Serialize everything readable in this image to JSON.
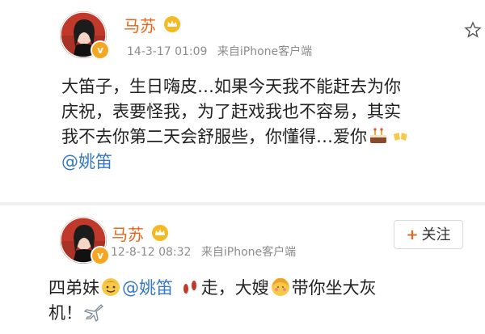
{
  "post1": {
    "username": "马苏",
    "timestamp": "14-3-17 01:09",
    "source": "来自iPhone客户端",
    "content_lines": [
      "大笛子，生日嗨皮…如果今天我不能赶去为你",
      "庆祝，表要怪我，为了赶戏我也不容易，其实",
      "我不去你第二天会舒服些，你懂得…爱你"
    ],
    "mention": "@姚笛",
    "avatar_icon": "avatar-icon",
    "verified_badge": "v",
    "emojis": [
      "cake-emoji",
      "cheers-emoji"
    ]
  },
  "post2": {
    "username": "马苏",
    "timestamp": "12-8-12 08:32",
    "source": "来自iPhone客户端",
    "follow_label": "+关注",
    "content_part1": "四弟妹",
    "mention": "@姚笛",
    "content_part2": "走，大嫂",
    "content_part3": "带你坐大灰",
    "content_line2": "机！",
    "avatar_icon": "avatar-icon",
    "verified_badge": "v",
    "emojis": [
      "smile-emoji",
      "footprints-emoji",
      "shy-emoji",
      "airplane-emoji"
    ]
  },
  "colors": {
    "username": "#e8641b",
    "mention": "#3478c6",
    "meta": "#8c8c8c",
    "badge": "#f5a623"
  }
}
